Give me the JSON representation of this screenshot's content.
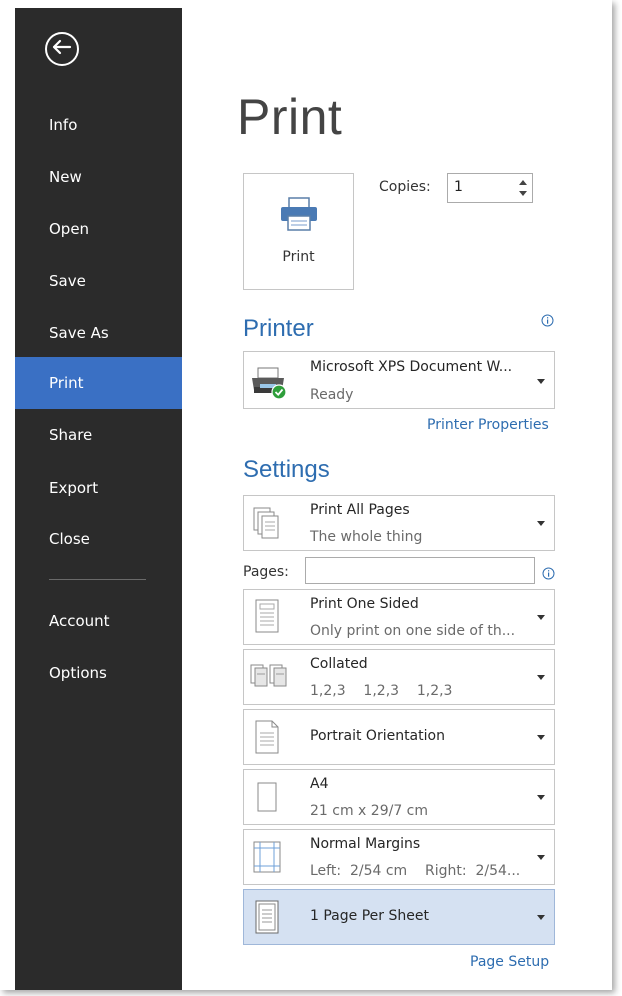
{
  "sidebar": {
    "items": [
      {
        "label": "Info"
      },
      {
        "label": "New"
      },
      {
        "label": "Open"
      },
      {
        "label": "Save"
      },
      {
        "label": "Save As"
      },
      {
        "label": "Print",
        "active": true
      },
      {
        "label": "Share"
      },
      {
        "label": "Export"
      },
      {
        "label": "Close"
      },
      {
        "label": "Account"
      },
      {
        "label": "Options"
      }
    ]
  },
  "main": {
    "title": "Print",
    "print_button_label": "Print",
    "copies_label": "Copies:",
    "copies_value": "1"
  },
  "printer": {
    "heading": "Printer",
    "name": "Microsoft XPS Document W...",
    "status": "Ready",
    "properties_link": "Printer Properties"
  },
  "settings": {
    "heading": "Settings",
    "pages_label": "Pages:",
    "pages_value": "",
    "items": [
      {
        "main": "Print All Pages",
        "sub": "The whole thing",
        "icon": "pages-icon"
      },
      {
        "main": "Print One Sided",
        "sub": "Only print on one side of th...",
        "icon": "one-sided-icon"
      },
      {
        "main": "Collated",
        "sub": "1,2,3    1,2,3    1,2,3",
        "icon": "collated-icon"
      },
      {
        "main": "Portrait Orientation",
        "sub": "",
        "icon": "portrait-icon"
      },
      {
        "main": "A4",
        "sub": "21 cm x 29/7 cm",
        "icon": "paper-size-icon"
      },
      {
        "main": "Normal Margins",
        "sub": "Left:  2/54 cm    Right:  2/54...",
        "icon": "margins-icon"
      },
      {
        "main": "1 Page Per Sheet",
        "sub": "",
        "icon": "pages-per-sheet-icon",
        "highlighted": true
      }
    ],
    "page_setup_link": "Page Setup"
  },
  "colors": {
    "sidebar_bg": "#2b2b2b",
    "active_bg": "#3a70c4",
    "accent": "#2e6db0",
    "highlight_bg": "#d5e1f2"
  }
}
